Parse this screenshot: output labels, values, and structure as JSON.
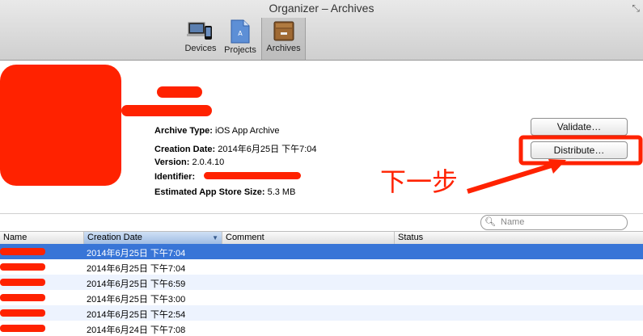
{
  "window": {
    "title": "Organizer – Archives"
  },
  "toolbar": {
    "items": [
      {
        "label": "Devices",
        "icon": "devices-icon"
      },
      {
        "label": "Projects",
        "icon": "projects-icon"
      },
      {
        "label": "Archives",
        "icon": "archives-icon",
        "selected": true
      }
    ]
  },
  "details": {
    "archive_type_label": "Archive Type:",
    "archive_type_value": "iOS App Archive",
    "creation_date_label": "Creation Date:",
    "creation_date_value": "2014年6月25日 下午7:04",
    "version_label": "Version:",
    "version_value": "2.0.4.10",
    "identifier_label": "Identifier:",
    "size_label": "Estimated App Store Size:",
    "size_value": "5.3 MB"
  },
  "buttons": {
    "validate": "Validate…",
    "distribute": "Distribute…"
  },
  "annotation": {
    "text": "下一步",
    "color": "#ff2200"
  },
  "search": {
    "placeholder": "Name"
  },
  "table": {
    "columns": [
      "Name",
      "Creation Date",
      "Comment",
      "Status"
    ],
    "sorted_column": "Creation Date",
    "rows": [
      {
        "date": "2014年6月25日 下午7:04",
        "selected": true
      },
      {
        "date": "2014年6月25日 下午7:04"
      },
      {
        "date": "2014年6月25日 下午6:59"
      },
      {
        "date": "2014年6月25日 下午3:00"
      },
      {
        "date": "2014年6月25日 下午2:54"
      },
      {
        "date": "2014年6月24日 下午7:08"
      }
    ]
  },
  "colors": {
    "selection": "#3875d7",
    "redaction": "#ff2200"
  }
}
